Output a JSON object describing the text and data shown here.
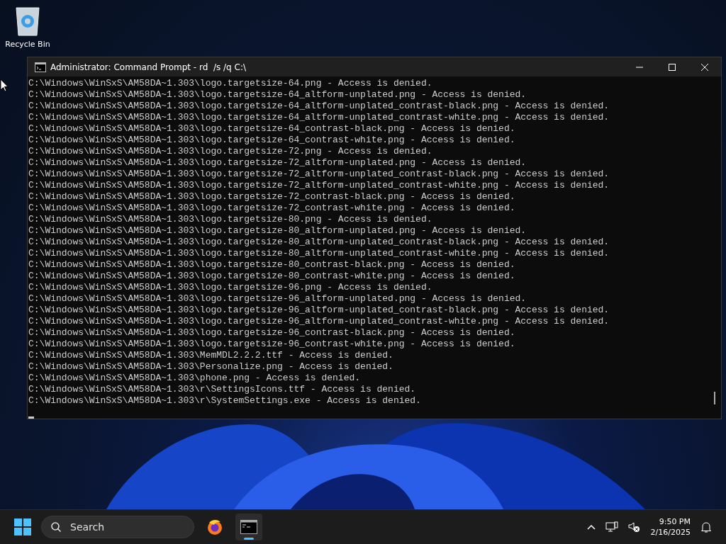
{
  "desktop": {
    "icons": [
      {
        "kind": "recycle-bin",
        "label": "Recycle Bin"
      }
    ]
  },
  "window": {
    "title": "Administrator: Command Prompt - rd  /s /q C:\\",
    "lines": [
      "C:\\Windows\\WinSxS\\AM58DA~1.303\\logo.targetsize-64.png - Access is denied.",
      "C:\\Windows\\WinSxS\\AM58DA~1.303\\logo.targetsize-64_altform-unplated.png - Access is denied.",
      "C:\\Windows\\WinSxS\\AM58DA~1.303\\logo.targetsize-64_altform-unplated_contrast-black.png - Access is denied.",
      "C:\\Windows\\WinSxS\\AM58DA~1.303\\logo.targetsize-64_altform-unplated_contrast-white.png - Access is denied.",
      "C:\\Windows\\WinSxS\\AM58DA~1.303\\logo.targetsize-64_contrast-black.png - Access is denied.",
      "C:\\Windows\\WinSxS\\AM58DA~1.303\\logo.targetsize-64_contrast-white.png - Access is denied.",
      "C:\\Windows\\WinSxS\\AM58DA~1.303\\logo.targetsize-72.png - Access is denied.",
      "C:\\Windows\\WinSxS\\AM58DA~1.303\\logo.targetsize-72_altform-unplated.png - Access is denied.",
      "C:\\Windows\\WinSxS\\AM58DA~1.303\\logo.targetsize-72_altform-unplated_contrast-black.png - Access is denied.",
      "C:\\Windows\\WinSxS\\AM58DA~1.303\\logo.targetsize-72_altform-unplated_contrast-white.png - Access is denied.",
      "C:\\Windows\\WinSxS\\AM58DA~1.303\\logo.targetsize-72_contrast-black.png - Access is denied.",
      "C:\\Windows\\WinSxS\\AM58DA~1.303\\logo.targetsize-72_contrast-white.png - Access is denied.",
      "C:\\Windows\\WinSxS\\AM58DA~1.303\\logo.targetsize-80.png - Access is denied.",
      "C:\\Windows\\WinSxS\\AM58DA~1.303\\logo.targetsize-80_altform-unplated.png - Access is denied.",
      "C:\\Windows\\WinSxS\\AM58DA~1.303\\logo.targetsize-80_altform-unplated_contrast-black.png - Access is denied.",
      "C:\\Windows\\WinSxS\\AM58DA~1.303\\logo.targetsize-80_altform-unplated_contrast-white.png - Access is denied.",
      "C:\\Windows\\WinSxS\\AM58DA~1.303\\logo.targetsize-80_contrast-black.png - Access is denied.",
      "C:\\Windows\\WinSxS\\AM58DA~1.303\\logo.targetsize-80_contrast-white.png - Access is denied.",
      "C:\\Windows\\WinSxS\\AM58DA~1.303\\logo.targetsize-96.png - Access is denied.",
      "C:\\Windows\\WinSxS\\AM58DA~1.303\\logo.targetsize-96_altform-unplated.png - Access is denied.",
      "C:\\Windows\\WinSxS\\AM58DA~1.303\\logo.targetsize-96_altform-unplated_contrast-black.png - Access is denied.",
      "C:\\Windows\\WinSxS\\AM58DA~1.303\\logo.targetsize-96_altform-unplated_contrast-white.png - Access is denied.",
      "C:\\Windows\\WinSxS\\AM58DA~1.303\\logo.targetsize-96_contrast-black.png - Access is denied.",
      "C:\\Windows\\WinSxS\\AM58DA~1.303\\logo.targetsize-96_contrast-white.png - Access is denied.",
      "C:\\Windows\\WinSxS\\AM58DA~1.303\\MemMDL2.2.2.ttf - Access is denied.",
      "C:\\Windows\\WinSxS\\AM58DA~1.303\\Personalize.png - Access is denied.",
      "C:\\Windows\\WinSxS\\AM58DA~1.303\\phone.png - Access is denied.",
      "C:\\Windows\\WinSxS\\AM58DA~1.303\\r\\SettingsIcons.ttf - Access is denied.",
      "C:\\Windows\\WinSxS\\AM58DA~1.303\\r\\SystemSettings.exe - Access is denied."
    ]
  },
  "taskbar": {
    "search": {
      "placeholder": "Search"
    },
    "apps": [
      {
        "kind": "browser",
        "selected": false
      },
      {
        "kind": "terminal",
        "selected": true
      }
    ],
    "time": "9:50 PM",
    "date": "2/16/2025"
  }
}
